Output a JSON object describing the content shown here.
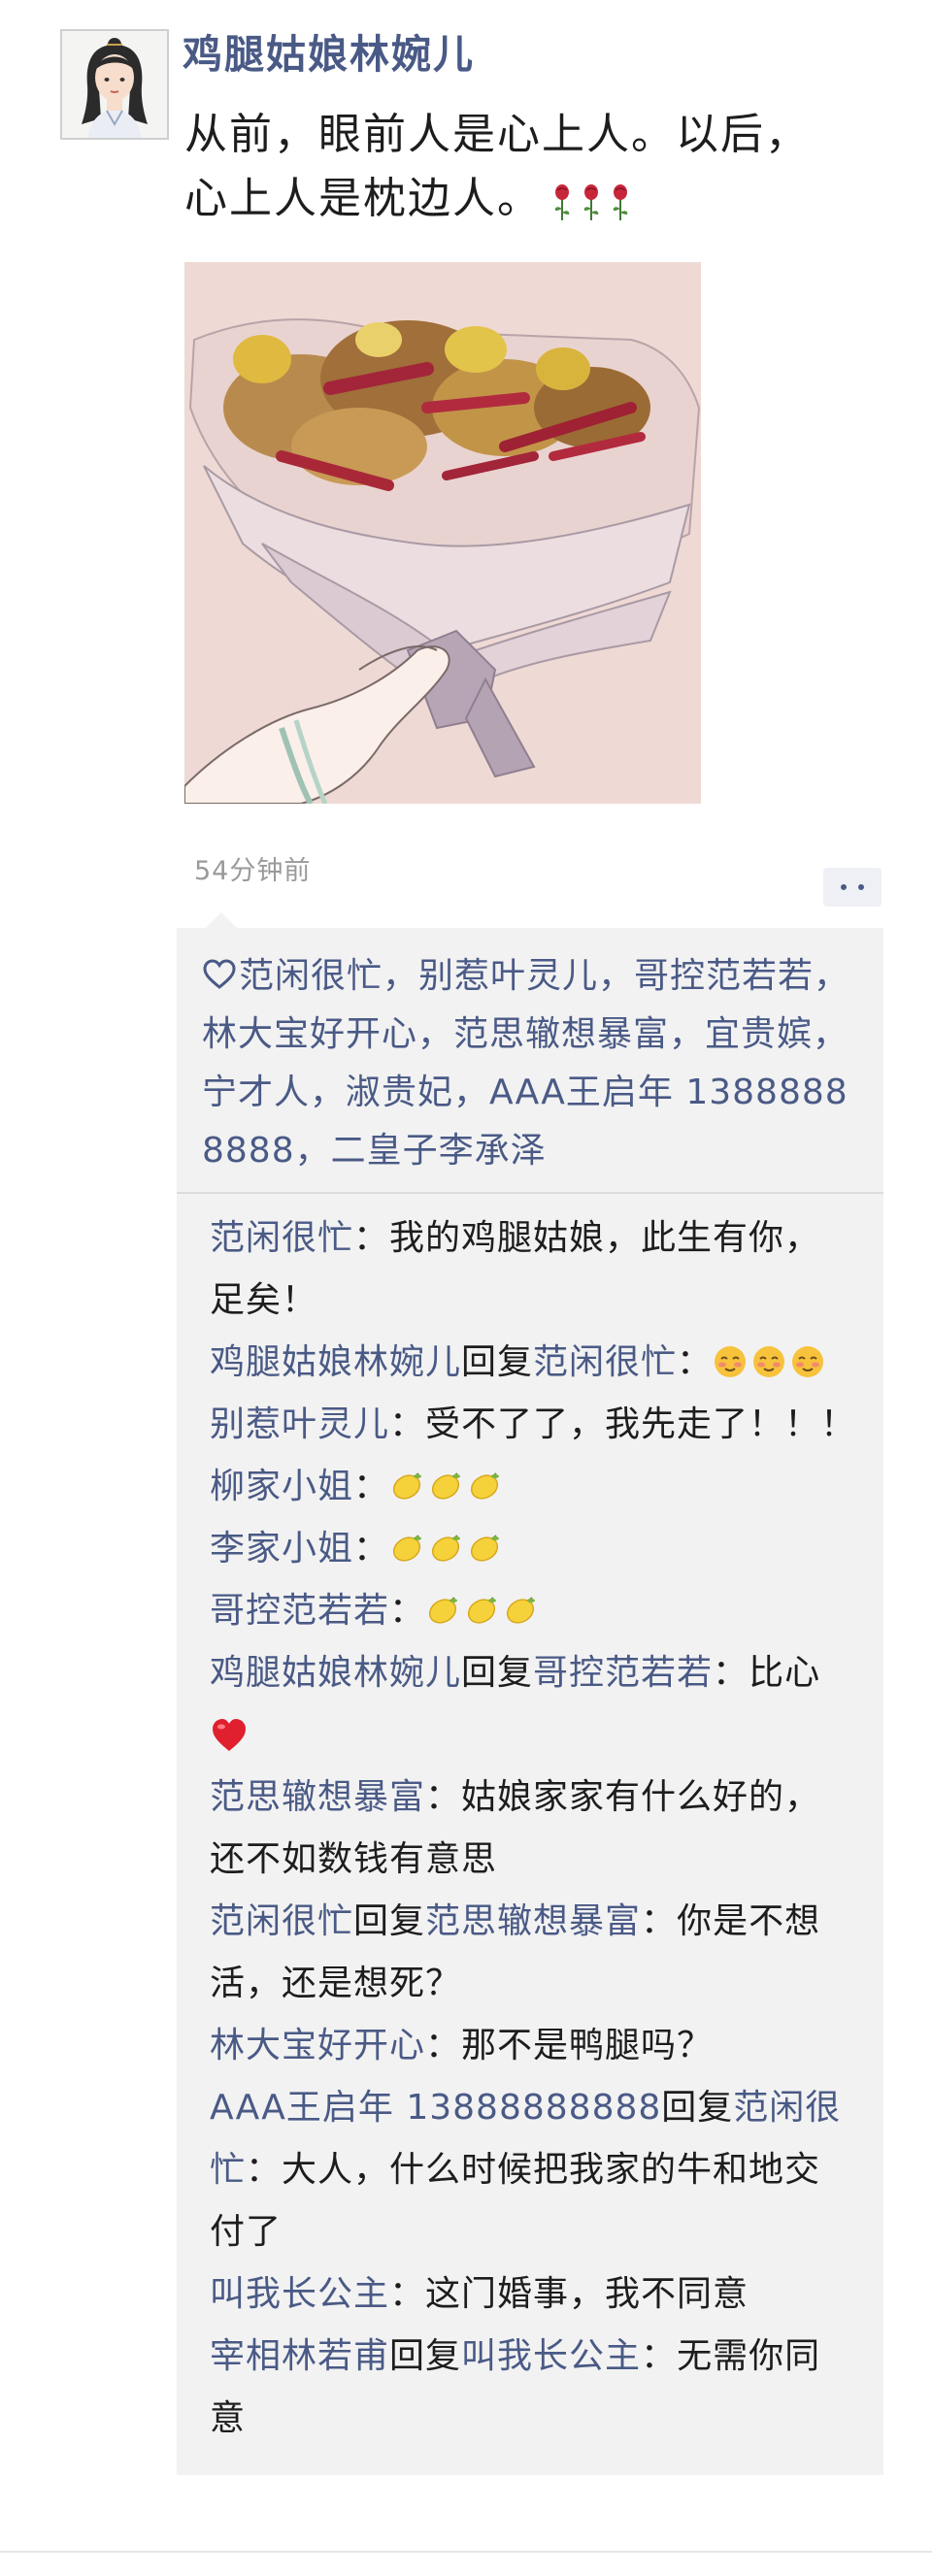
{
  "post": {
    "author": "鸡腿姑娘林婉儿",
    "text_lines": [
      "从前，眼前人是心上人。以后，",
      "心上人是枕边人。"
    ],
    "time": "54分钟前"
  },
  "likes": {
    "lines": [
      "范闲很忙，别惹叶灵儿，哥控范若若，",
      "林大宝好开心，范思辙想暴富，宜贵嫔，",
      "宁才人，淑贵妃，AAA王启年 1388888",
      "8888，二皇子李承泽"
    ]
  },
  "comments": [
    {
      "name": "范闲很忙",
      "reply_to": "",
      "sep": "：",
      "text_lines": [
        "我的鸡腿姑娘，此生有你，",
        "足矣！"
      ]
    },
    {
      "name": "鸡腿姑娘林婉儿",
      "reply_word": "回复",
      "reply_to": "范闲很忙",
      "sep": "："
    },
    {
      "name": "别惹叶灵儿",
      "sep": "：",
      "text_lines": [
        "受不了了，我先走了！！！"
      ]
    },
    {
      "name": "柳家小姐",
      "sep": "："
    },
    {
      "name": "李家小姐",
      "sep": "："
    },
    {
      "name": "哥控范若若",
      "sep": "："
    },
    {
      "name": "鸡腿姑娘林婉儿",
      "reply_word": "回复",
      "reply_to": "哥控范若若",
      "sep": "：",
      "text_lines": [
        "比心"
      ]
    },
    {
      "name": "范思辙想暴富",
      "sep": "：",
      "text_lines": [
        "姑娘家家有什么好的，",
        "还不如数钱有意思"
      ]
    },
    {
      "name": "范闲很忙",
      "reply_word": "回复",
      "reply_to": "范思辙想暴富",
      "sep": "：",
      "text_lines": [
        "你是不想",
        "活，还是想死？"
      ]
    },
    {
      "name": "林大宝好开心",
      "sep": "：",
      "text_lines": [
        "那不是鸭腿吗？"
      ]
    },
    {
      "name": "AAA王启年 13888888888",
      "reply_word": "回复",
      "reply_to_lines": [
        "范闲很",
        "忙"
      ],
      "sep": "：",
      "text_lines": [
        "大人，什么时候把我家的牛和地交",
        "付了"
      ]
    },
    {
      "name": "叫我长公主",
      "sep": "：",
      "text_lines": [
        "这门婚事，我不同意"
      ]
    },
    {
      "name": "宰相林若甫",
      "reply_word": "回复",
      "reply_to": "叫我长公主",
      "sep": "：",
      "text_lines": [
        "无需你同",
        "意"
      ]
    }
  ],
  "icons": {
    "heart": "heart-outline-icon",
    "rose": "rose-icon",
    "blush": "blush-face-icon",
    "lemon": "lemon-icon",
    "red_heart": "red-heart-icon",
    "more": "more-dots-icon"
  },
  "colors": {
    "name_blue": "#4a5a86",
    "comment_bg": "#f2f2f2",
    "time_gray": "#9a9a9a"
  }
}
